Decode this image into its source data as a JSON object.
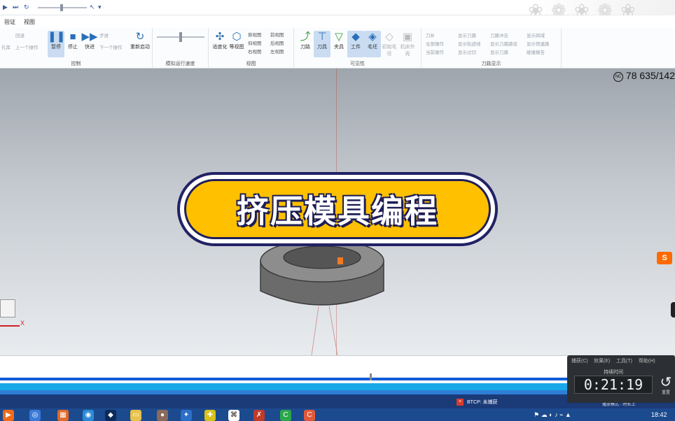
{
  "quick_access": {
    "play_icon": "▶",
    "skip_icon": "⏭",
    "loop_icon": "↻",
    "cursor_icon": "↖",
    "dropdown": "▾"
  },
  "menu": {
    "items": [
      "验证",
      "视图"
    ]
  },
  "ribbon": {
    "groups": [
      {
        "label": "控制"
      },
      {
        "label": "模拟运行速度"
      },
      {
        "label": "视图"
      },
      {
        "label": "可见性"
      },
      {
        "label": "刀路显示"
      }
    ],
    "control": {
      "small_left": "孔库",
      "prev_dim": "回退",
      "prev_op": "上一个操作",
      "pause": "暂停",
      "stop": "停止",
      "fast": "快进",
      "step_dim": "步进",
      "next_op": "下一个操作",
      "restart": "重新启动"
    },
    "view": {
      "fit": "适度化",
      "iso": "等视图",
      "top": "俯视图",
      "front": "前视图",
      "left": "左视图",
      "bottom": "仰视图",
      "back": "后视图",
      "right": "右视图"
    },
    "visibility": {
      "toolpath": "刀路",
      "tool": "刀具",
      "holder": "夹具",
      "workpiece": "工件",
      "stock": "毛坯",
      "initial_stock": "初始毛坯",
      "machine": "机床外壳"
    },
    "toolpath_display": [
      "刀补",
      "显示刀路",
      "刀路冲击",
      "显示跨域",
      "全部操作",
      "显示轨迹线",
      "显示刀路路径",
      "显示快速路",
      "当前操作",
      "显示过切",
      "显示刀路",
      "碰撞报告"
    ]
  },
  "viewport": {
    "nc_readout": "78 635/142",
    "nc_icon": "NC",
    "banner_text": "挤压模具编程",
    "axis_label": "X",
    "logo": "S"
  },
  "timer": {
    "menu": [
      "捕获(C)",
      "效果(E)",
      "工具(T)",
      "帮助(H)"
    ],
    "label": "持续时间",
    "time": "0:21:19",
    "reset_label": "重置"
  },
  "infobar": {
    "badge": "×",
    "text": "BTCP: 未捕获",
    "right_text": "播放模式 · 时长上"
  },
  "taskbar": {
    "time": "18:42"
  },
  "colors": {
    "banner_fill": "#ffc000",
    "banner_border": "#1f1f5c",
    "taskbar": "#1c4a8e",
    "band_cyan": "#1aa9e8"
  }
}
